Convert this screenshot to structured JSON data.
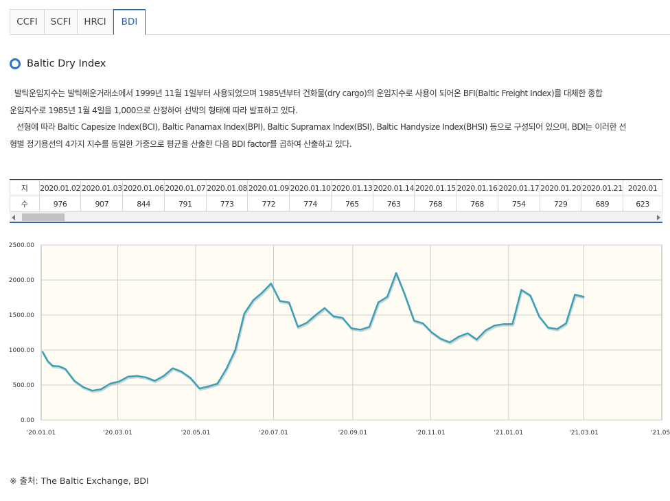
{
  "tabs": [
    {
      "label": "CCFI",
      "active": false
    },
    {
      "label": "SCFI",
      "active": false
    },
    {
      "label": "HRCI",
      "active": false
    },
    {
      "label": "BDI",
      "active": true
    }
  ],
  "section_title": "Baltic Dry Index",
  "description": [
    "  발틱운임지수는 발틱해운거래소에서 1999년 11월 1일부터 사용되었으며 1985년부터 건화물(dry cargo)의 운임지수로 사용이 되어온 BFI(Baltic Freight Index)를 대체한 종합",
    "운임지수로 1985년 1월 4일을 1,000으로 산정하여 선박의 형태에 따라 발표하고 있다.",
    "   선형에 따라 Baltic Capesize Index(BCI), Baltic Panamax Index(BPI), Baltic Supramax Index(BSI), Baltic Handysize Index(BHSI) 등으로 구성되어 있으며, BDI는 이러한 선",
    "형별 정기용선의 4가지 지수를 동일한 가중으로 평균을 산출한 다음 BDI factor를 곱하여 산출하고 있다."
  ],
  "table": {
    "header_label": "지",
    "value_label": "수",
    "dates": [
      "2020.01.02",
      "2020.01.03",
      "2020.01.06",
      "2020.01.07",
      "2020.01.08",
      "2020.01.09",
      "2020.01.10",
      "2020.01.13",
      "2020.01.14",
      "2020.01.15",
      "2020.01.16",
      "2020.01.17",
      "2020.01.20",
      "2020.01.21",
      "2020.01"
    ],
    "values": [
      "976",
      "907",
      "844",
      "791",
      "773",
      "772",
      "774",
      "765",
      "763",
      "768",
      "768",
      "754",
      "729",
      "689",
      "623"
    ]
  },
  "source": "※ 출처: The Baltic Exchange, BDI",
  "colors": {
    "accent": "#2d64b3",
    "line": "#3aa0b8",
    "plot_bg": "#fffdf3"
  },
  "chart_data": {
    "type": "line",
    "title": "",
    "xlabel": "",
    "ylabel": "",
    "ylim": [
      0,
      2500
    ],
    "yticks": [
      "2500.00",
      "2000.00",
      "1500.00",
      "1000.00",
      "500.00",
      "0.00"
    ],
    "xticks": [
      "'20.01.01",
      "'20.03.01",
      "'20.05.01",
      "'20.07.01",
      "'20.09.01",
      "'20.11.01",
      "'21.01.01",
      "'21.03.01",
      "'21.05."
    ],
    "xtick_dates": [
      "2020-01-01",
      "2020-03-01",
      "2020-05-01",
      "2020-07-01",
      "2020-09-01",
      "2020-11-01",
      "2021-01-01",
      "2021-03-01",
      "2021-05-01"
    ],
    "grid": true,
    "series": [
      {
        "name": "",
        "x": [
          "2020-01-02",
          "2020-01-06",
          "2020-01-10",
          "2020-01-15",
          "2020-01-20",
          "2020-01-27",
          "2020-02-03",
          "2020-02-10",
          "2020-02-17",
          "2020-02-24",
          "2020-03-02",
          "2020-03-09",
          "2020-03-16",
          "2020-03-23",
          "2020-03-30",
          "2020-04-06",
          "2020-04-13",
          "2020-04-20",
          "2020-04-27",
          "2020-05-04",
          "2020-05-11",
          "2020-05-18",
          "2020-05-25",
          "2020-06-01",
          "2020-06-08",
          "2020-06-15",
          "2020-06-22",
          "2020-06-29",
          "2020-07-06",
          "2020-07-13",
          "2020-07-20",
          "2020-07-27",
          "2020-08-03",
          "2020-08-10",
          "2020-08-17",
          "2020-08-24",
          "2020-08-31",
          "2020-09-07",
          "2020-09-14",
          "2020-09-21",
          "2020-09-28",
          "2020-10-05",
          "2020-10-12",
          "2020-10-19",
          "2020-10-26",
          "2020-11-02",
          "2020-11-09",
          "2020-11-16",
          "2020-11-23",
          "2020-11-30",
          "2020-12-07",
          "2020-12-14",
          "2020-12-21",
          "2020-12-28",
          "2021-01-04",
          "2021-01-11",
          "2021-01-18",
          "2021-01-25",
          "2021-02-01",
          "2021-02-08",
          "2021-02-15",
          "2021-02-22",
          "2021-03-01"
        ],
        "y": [
          976,
          844,
          774,
          768,
          729,
          560,
          470,
          420,
          440,
          520,
          550,
          620,
          630,
          610,
          560,
          630,
          740,
          690,
          600,
          450,
          480,
          520,
          730,
          1000,
          1520,
          1710,
          1820,
          1950,
          1700,
          1680,
          1330,
          1390,
          1500,
          1600,
          1480,
          1460,
          1310,
          1290,
          1330,
          1680,
          1760,
          2100,
          1780,
          1420,
          1380,
          1250,
          1160,
          1110,
          1190,
          1240,
          1150,
          1280,
          1350,
          1370,
          1370,
          1860,
          1780,
          1480,
          1320,
          1300,
          1380,
          1790,
          1760
        ]
      }
    ]
  }
}
